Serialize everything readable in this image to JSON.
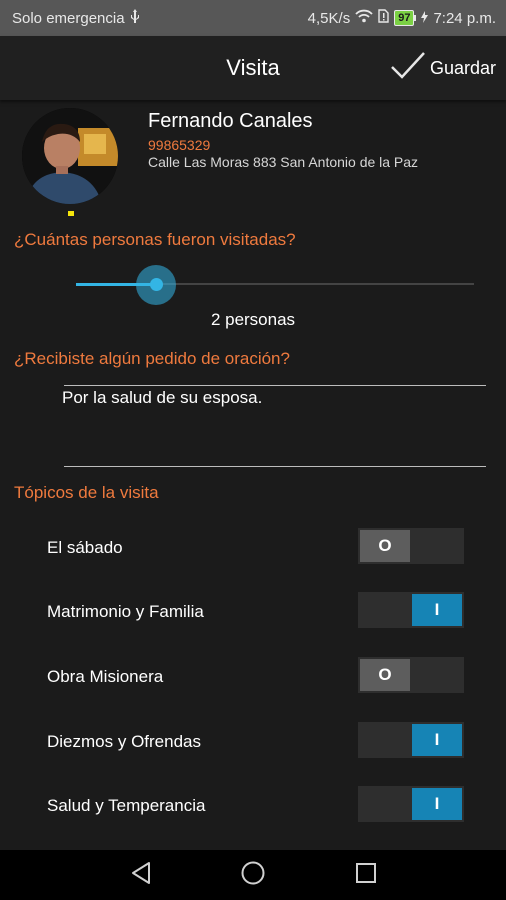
{
  "status_bar": {
    "carrier": "Solo emergencia",
    "network_speed": "4,5K/s",
    "battery_level": "97",
    "time": "7:24 p.m."
  },
  "app_bar": {
    "title": "Visita",
    "save_label": "Guardar"
  },
  "profile": {
    "name": "Fernando Canales",
    "phone": "99865329",
    "address": "Calle Las Moras 883 San Antonio de la Paz"
  },
  "people_question": {
    "label": "¿Cuántas personas fueron visitadas?",
    "slider_fraction": 0.2,
    "value_text": "2 personas"
  },
  "prayer_request": {
    "label": "¿Recibiste algún pedido de oración?",
    "value": "Por la salud de su esposa."
  },
  "topics": {
    "label": "Tópicos de la visita",
    "items": [
      {
        "label": "El sábado",
        "state": "off",
        "knob": "O"
      },
      {
        "label": "Matrimonio y Familia",
        "state": "on",
        "knob": "I"
      },
      {
        "label": "Obra Misionera",
        "state": "off",
        "knob": "O"
      },
      {
        "label": "Diezmos y Ofrendas",
        "state": "on",
        "knob": "I"
      },
      {
        "label": "Salud y Temperancia",
        "state": "on",
        "knob": "I"
      }
    ]
  },
  "colors": {
    "accent_orange": "#ef7a3e",
    "accent_blue": "#1684b5",
    "slider_blue": "#33b5e5"
  },
  "icons": {
    "save": "checkmark-icon",
    "nav_back": "triangle-back-icon",
    "nav_home": "circle-home-icon",
    "nav_recents": "square-recents-icon"
  }
}
